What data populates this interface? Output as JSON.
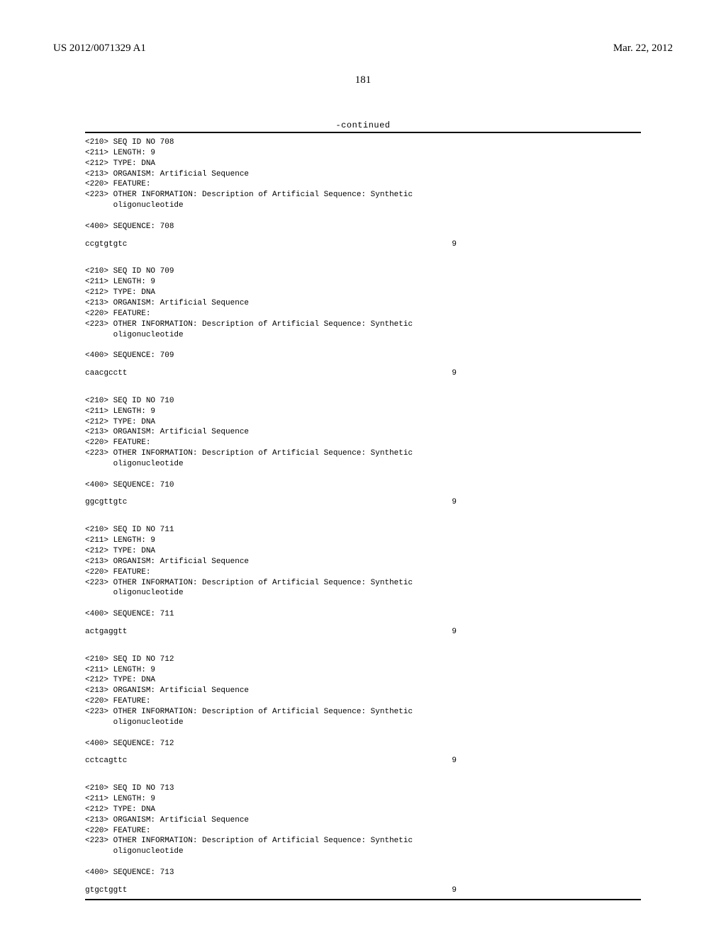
{
  "header": {
    "pub_no": "US 2012/0071329 A1",
    "pub_date": "Mar. 22, 2012"
  },
  "page_number": "181",
  "continued_label": "-continued",
  "entries": [
    {
      "id": "708",
      "l210": "<210> SEQ ID NO 708",
      "l211": "<211> LENGTH: 9",
      "l212": "<212> TYPE: DNA",
      "l213": "<213> ORGANISM: Artificial Sequence",
      "l220": "<220> FEATURE:",
      "l223a": "<223> OTHER INFORMATION: Description of Artificial Sequence: Synthetic",
      "l223b": "      oligonucleotide",
      "l400": "<400> SEQUENCE: 708",
      "seq": "ccgtgtgtc",
      "len": "9"
    },
    {
      "id": "709",
      "l210": "<210> SEQ ID NO 709",
      "l211": "<211> LENGTH: 9",
      "l212": "<212> TYPE: DNA",
      "l213": "<213> ORGANISM: Artificial Sequence",
      "l220": "<220> FEATURE:",
      "l223a": "<223> OTHER INFORMATION: Description of Artificial Sequence: Synthetic",
      "l223b": "      oligonucleotide",
      "l400": "<400> SEQUENCE: 709",
      "seq": "caacgcctt",
      "len": "9"
    },
    {
      "id": "710",
      "l210": "<210> SEQ ID NO 710",
      "l211": "<211> LENGTH: 9",
      "l212": "<212> TYPE: DNA",
      "l213": "<213> ORGANISM: Artificial Sequence",
      "l220": "<220> FEATURE:",
      "l223a": "<223> OTHER INFORMATION: Description of Artificial Sequence: Synthetic",
      "l223b": "      oligonucleotide",
      "l400": "<400> SEQUENCE: 710",
      "seq": "ggcgttgtc",
      "len": "9"
    },
    {
      "id": "711",
      "l210": "<210> SEQ ID NO 711",
      "l211": "<211> LENGTH: 9",
      "l212": "<212> TYPE: DNA",
      "l213": "<213> ORGANISM: Artificial Sequence",
      "l220": "<220> FEATURE:",
      "l223a": "<223> OTHER INFORMATION: Description of Artificial Sequence: Synthetic",
      "l223b": "      oligonucleotide",
      "l400": "<400> SEQUENCE: 711",
      "seq": "actgaggtt",
      "len": "9"
    },
    {
      "id": "712",
      "l210": "<210> SEQ ID NO 712",
      "l211": "<211> LENGTH: 9",
      "l212": "<212> TYPE: DNA",
      "l213": "<213> ORGANISM: Artificial Sequence",
      "l220": "<220> FEATURE:",
      "l223a": "<223> OTHER INFORMATION: Description of Artificial Sequence: Synthetic",
      "l223b": "      oligonucleotide",
      "l400": "<400> SEQUENCE: 712",
      "seq": "cctcagttc",
      "len": "9"
    },
    {
      "id": "713",
      "l210": "<210> SEQ ID NO 713",
      "l211": "<211> LENGTH: 9",
      "l212": "<212> TYPE: DNA",
      "l213": "<213> ORGANISM: Artificial Sequence",
      "l220": "<220> FEATURE:",
      "l223a": "<223> OTHER INFORMATION: Description of Artificial Sequence: Synthetic",
      "l223b": "      oligonucleotide",
      "l400": "<400> SEQUENCE: 713",
      "seq": "gtgctggtt",
      "len": "9"
    }
  ]
}
